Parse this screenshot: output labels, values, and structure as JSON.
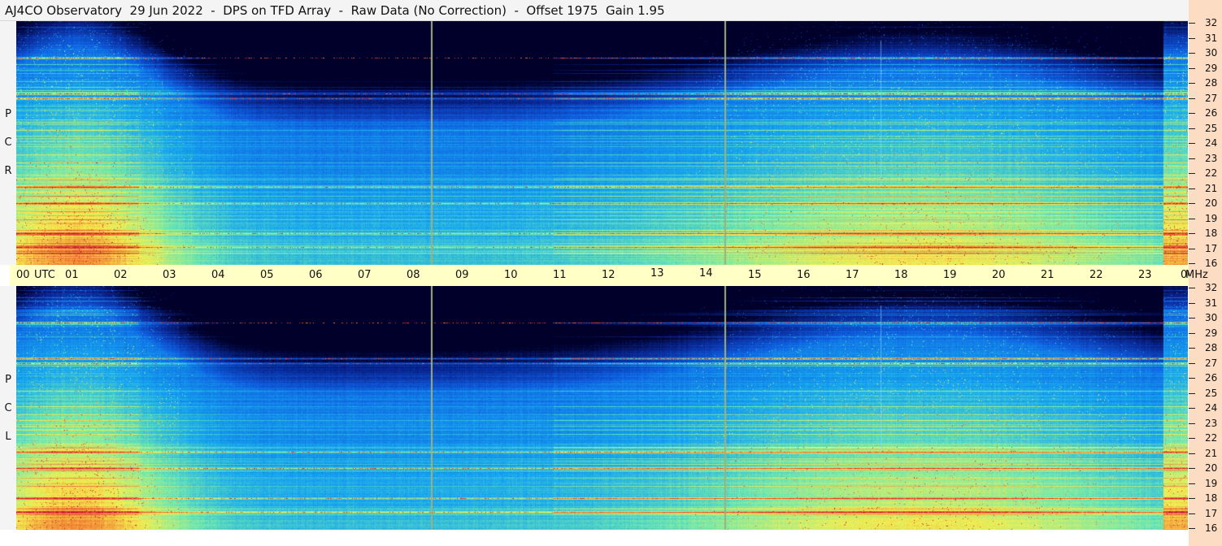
{
  "title": "AJ4CO Observatory  29 Jun 2022  -  DPS on TFD Array  -  Raw Data (No Correction)  -  Offset 1975  Gain 1.95",
  "chart_data": [
    {
      "type": "heatmap",
      "panel": "top",
      "polarization_label": [
        "R",
        "C",
        "P"
      ],
      "x_axis": "UTC hours",
      "xlim": [
        0,
        24
      ],
      "y_axis": "MHz",
      "ylim": [
        16,
        32
      ],
      "y_ticks": [
        "16",
        "17",
        "18",
        "19",
        "20",
        "21",
        "22",
        "23",
        "24",
        "25",
        "26",
        "27",
        "28",
        "29",
        "30",
        "31",
        "32"
      ],
      "strong_bands_mhz": [
        17.1,
        18.0,
        20.0,
        21.1,
        27.0,
        27.3,
        29.7
      ],
      "vertical_markers_utc": [
        8.5,
        14.5
      ],
      "colormap": [
        "#00002a",
        "#0a2a9a",
        "#0f5fe0",
        "#16a6f0",
        "#6fe8b0",
        "#f4f050",
        "#f07030",
        "#c8143c"
      ]
    },
    {
      "type": "heatmap",
      "panel": "bottom",
      "polarization_label": [
        "L",
        "C",
        "P"
      ],
      "x_axis": "UTC hours",
      "xlim": [
        0,
        24
      ],
      "y_axis": "MHz",
      "ylim": [
        16,
        32
      ],
      "y_ticks": [
        "16",
        "17",
        "18",
        "19",
        "20",
        "21",
        "22",
        "23",
        "24",
        "25",
        "26",
        "27",
        "28",
        "29",
        "30",
        "31",
        "32"
      ],
      "strong_bands_mhz": [
        17.1,
        18.0,
        20.0,
        21.1,
        27.0,
        27.3,
        29.7
      ],
      "vertical_markers_utc": [
        8.5,
        14.5
      ],
      "colormap": [
        "#00002a",
        "#0a2a9a",
        "#0f5fe0",
        "#16a6f0",
        "#6fe8b0",
        "#f4f050",
        "#f07030",
        "#c8143c"
      ]
    }
  ],
  "time_axis": {
    "labels": [
      "00",
      "01",
      "02",
      "03",
      "04",
      "05",
      "06",
      "07",
      "08",
      "09",
      "10",
      "11",
      "12",
      "13",
      "14",
      "15",
      "16",
      "17",
      "18",
      "19",
      "20",
      "21",
      "22",
      "23",
      "00"
    ],
    "utc_label": "UTC",
    "mhz_label": "MHz"
  }
}
